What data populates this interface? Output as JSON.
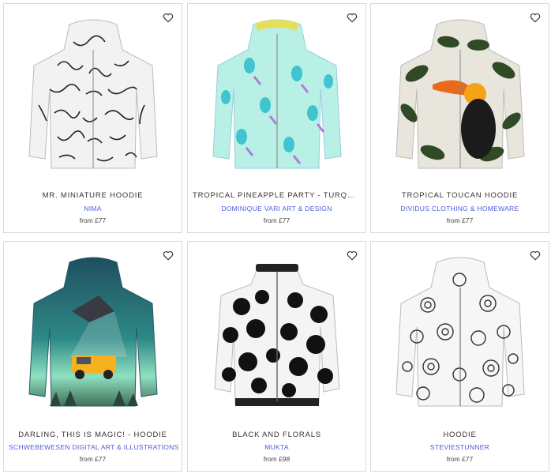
{
  "products": [
    {
      "title": "MR. MINIATURE HOODIE",
      "artist": "NIMA",
      "price": "from £77",
      "icon": "heart-icon",
      "body_color": "#f2f2f2",
      "pattern_color": "#222222"
    },
    {
      "title": "TROPICAL PINEAPPLE PARTY - TURQUOISE A...",
      "artist": "DOMINIQUE VARI ART & DESIGN",
      "price": "from £77",
      "icon": "heart-icon",
      "body_color": "#b8f0e6",
      "pattern_color": "#3fc4d0"
    },
    {
      "title": "TROPICAL TOUCAN HOODIE",
      "artist": "DIVIDUS CLOTHING & HOMEWARE",
      "price": "from £77",
      "icon": "heart-icon",
      "body_color": "#e8e6dc",
      "pattern_color": "#2f4a24"
    },
    {
      "title": "DARLING, THIS IS MAGIC! - HOODIE",
      "artist": "SCHWEBEWESEN DIGITAL ART & ILLUSTRATIONS",
      "price": "from £77",
      "icon": "heart-icon",
      "body_color": "#1f5a66",
      "pattern_color": "#6fd6c0"
    },
    {
      "title": "BLACK AND FLORALS",
      "artist": "MUKTA",
      "price": "from £98",
      "icon": "heart-icon",
      "body_color": "#f4f4f4",
      "pattern_color": "#111111"
    },
    {
      "title": "HOODIE",
      "artist": "STEVIESTUNNER",
      "price": "from £77",
      "icon": "heart-icon",
      "body_color": "#f6f6f6",
      "pattern_color": "#333333"
    }
  ]
}
